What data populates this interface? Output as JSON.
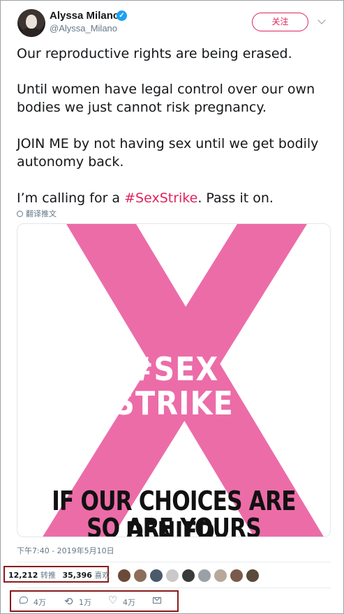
{
  "author": {
    "name": "Alyssa Milano",
    "handle": "@Alyssa_Milano",
    "verified_mark": "✓"
  },
  "follow_label": "关注",
  "tweet": {
    "line1": "Our reproductive rights are being erased.",
    "line2": "Until women have legal control over our own bodies we just cannot risk pregnancy.",
    "line3": "JOIN ME by not having sex until we get bodily autonomy back.",
    "line4_prefix": "I’m calling for a ",
    "hashtag": "#SexStrike",
    "line4_suffix": ". Pass it on."
  },
  "translate_label": "翻译推文",
  "media": {
    "headline_1": "#SEX",
    "headline_2": "STRIKE",
    "slogan_1": "IF OUR CHOICES ARE DENIED,",
    "slogan_2": "SO ARE YOURS",
    "accent_color": "#ec6ca8"
  },
  "timestamp": "下午7:40 - 2019年5月10日",
  "stats": {
    "retweets_count": "12,212",
    "retweets_label": "转推",
    "likes_count": "35,396",
    "likes_label": "喜欢"
  },
  "liker_avatar_colors": [
    "#6b4a3a",
    "#8d6e5a",
    "#4a5a6a",
    "#c9c9c9",
    "#3a3a3a",
    "#9aa0a6",
    "#b8a89a",
    "#7a5a4a",
    "#5a4a3a"
  ],
  "actions": {
    "reply_count": "4万",
    "retweet_count": "1万",
    "like_count": "4万"
  },
  "icons": {
    "retweet": "⟲",
    "like": "♡"
  }
}
